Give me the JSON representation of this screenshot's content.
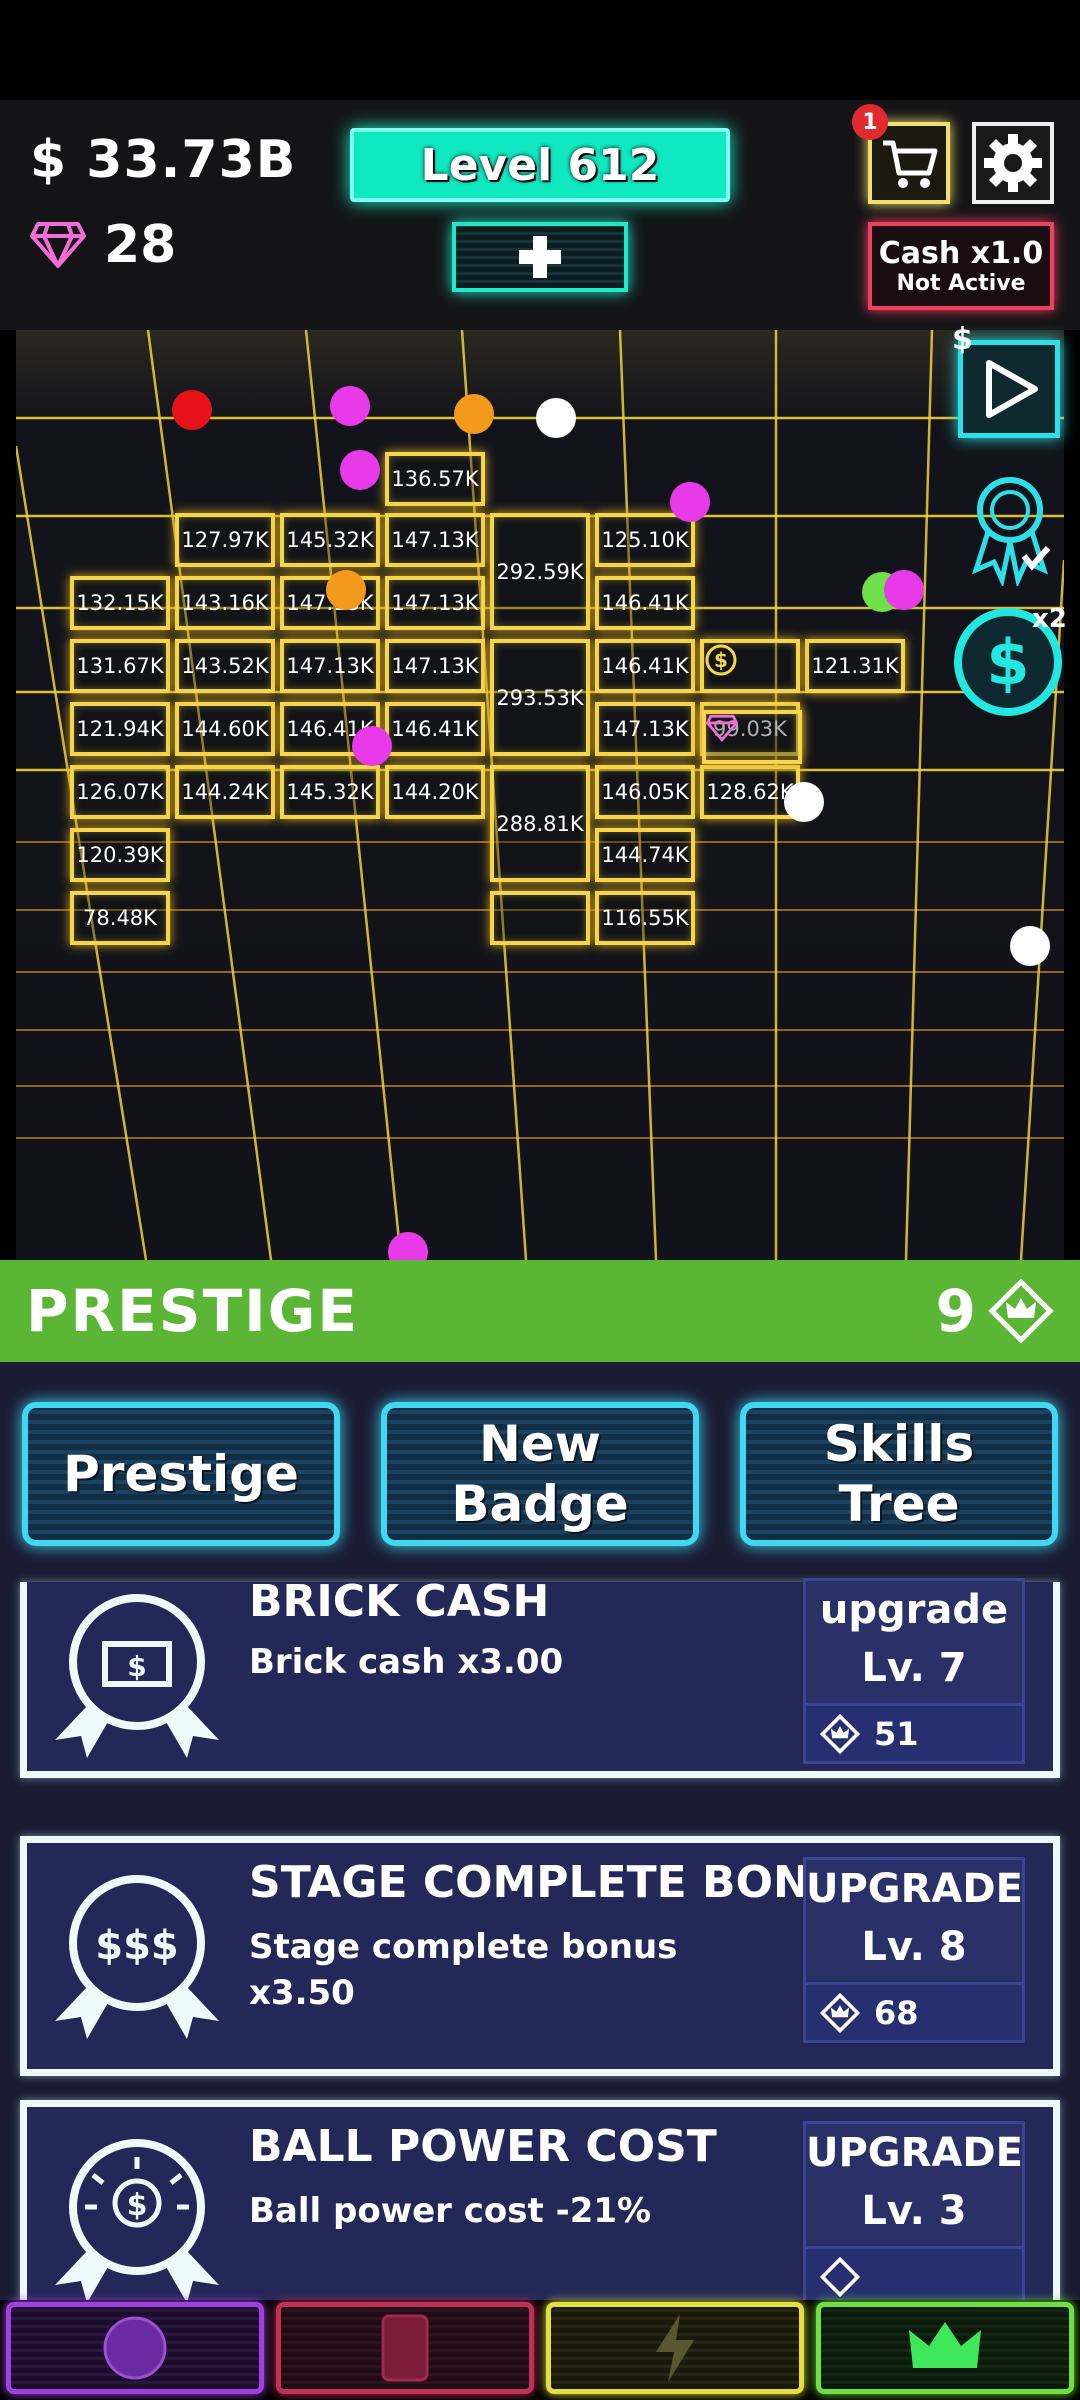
{
  "header": {
    "cash": "$ 33.73B",
    "gems": "28",
    "level": "Level 612",
    "cart_badge": "1",
    "cash_multiplier": "Cash x1.0",
    "cash_multiplier_status": "Not Active"
  },
  "field": {
    "ad_dollar": "$",
    "double_label": "x2",
    "bricks": [
      {
        "label": "136.57K"
      },
      {
        "label": "127.97K"
      },
      {
        "label": "145.32K"
      },
      {
        "label": "147.13K"
      },
      {
        "label": "292.59K"
      },
      {
        "label": "125.10K"
      },
      {
        "label": "132.15K"
      },
      {
        "label": "143.16K"
      },
      {
        "label": "147.13K"
      },
      {
        "label": "147.13K"
      },
      {
        "label": "146.41K"
      },
      {
        "label": "131.67K"
      },
      {
        "label": "143.52K"
      },
      {
        "label": "147.13K"
      },
      {
        "label": "147.13K"
      },
      {
        "label": "293.53K"
      },
      {
        "label": "146.41K"
      },
      {
        "label": "121.31K"
      },
      {
        "label": "121.94K"
      },
      {
        "label": "144.60K"
      },
      {
        "label": "146.41K"
      },
      {
        "label": "146.41K"
      },
      {
        "label": "147.13K"
      },
      {
        "label": "99.03K"
      },
      {
        "label": "126.07K"
      },
      {
        "label": "144.24K"
      },
      {
        "label": "145.32K"
      },
      {
        "label": "144.20K"
      },
      {
        "label": "288.81K"
      },
      {
        "label": "146.05K"
      },
      {
        "label": "128.62K"
      },
      {
        "label": "120.39K"
      },
      {
        "label": "144.74K"
      },
      {
        "label": "78.48K"
      },
      {
        "label": ""
      },
      {
        "label": "116.55K"
      }
    ],
    "balls": [
      {
        "color": "#e8121a"
      },
      {
        "color": "#e83ae8"
      },
      {
        "color": "#f39a1c"
      },
      {
        "color": "#ffffff"
      },
      {
        "color": "#e83ae8"
      },
      {
        "color": "#e83ae8"
      },
      {
        "color": "#f39a1c"
      },
      {
        "color": "#6ee04a"
      },
      {
        "color": "#e83ae8"
      },
      {
        "color": "#e83ae8"
      },
      {
        "color": "#ffffff"
      },
      {
        "color": "#ffffff"
      },
      {
        "color": "#e83ae8"
      }
    ]
  },
  "prestige": {
    "title": "PRESTIGE",
    "points": "9",
    "tabs": [
      "Prestige",
      "New\nBadge",
      "Skills\nTree"
    ]
  },
  "cards": [
    {
      "title": "BRICK CASH",
      "desc": "Brick cash x3.00",
      "upgrade_label": "upgrade",
      "level": "Lv. 7",
      "cost": "51",
      "icon": "cash-note-medal-icon"
    },
    {
      "title": "STAGE COMPLETE BONUS",
      "desc": "Stage complete bonus x3.50",
      "upgrade_label": "UPGRADE",
      "level": "Lv. 8",
      "cost": "68",
      "icon": "coins-medal-icon"
    },
    {
      "title": "BALL POWER COST",
      "desc": "Ball power cost -21%",
      "upgrade_label": "UPGRADE",
      "level": "Lv. 3",
      "cost": "",
      "icon": "dollar-burst-medal-icon"
    }
  ],
  "nav": [
    {
      "name": "nav-balls",
      "icon": "ball-icon",
      "color": "#a040e0"
    },
    {
      "name": "nav-cards",
      "icon": "card-icon",
      "color": "#c0305a"
    },
    {
      "name": "nav-powerups",
      "icon": "lightning-icon",
      "color": "#e0e040"
    },
    {
      "name": "nav-prestige",
      "icon": "crown-icon",
      "color": "#70e040"
    }
  ],
  "colors": {
    "accent": "#10e8c0",
    "brick": "#f5d64a",
    "prestige_green": "#5cb635",
    "panel": "#1a1b33"
  }
}
